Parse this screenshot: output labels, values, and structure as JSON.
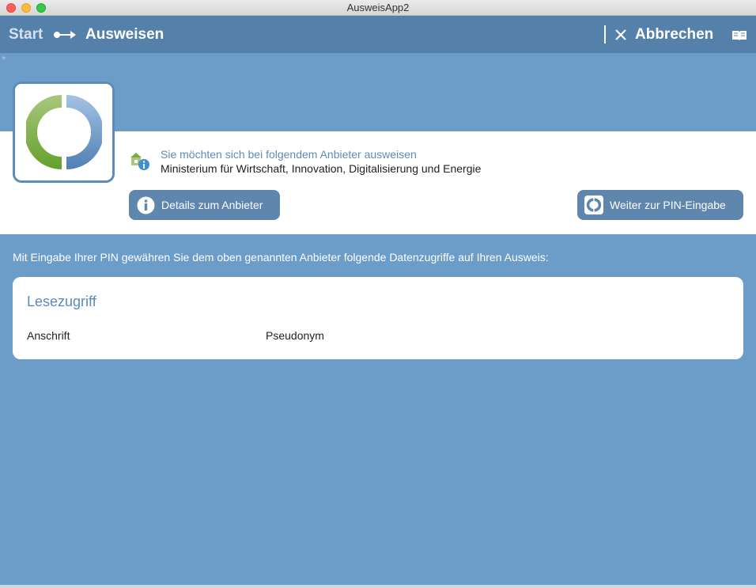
{
  "window": {
    "title": "AusweisApp2"
  },
  "navbar": {
    "breadcrumb_start": "Start",
    "breadcrumb_current": "Ausweisen",
    "cancel_label": "Abbrechen"
  },
  "provider": {
    "question": "Sie möchten sich bei folgendem Anbieter ausweisen",
    "name": "Ministerium für Wirtschaft, Innovation, Digitalisierung und Energie",
    "details_button": "Details zum Anbieter",
    "continue_button": "Weiter zur PIN-Eingabe"
  },
  "info_text": "Mit Eingabe Ihrer PIN gewähren Sie dem oben genannten Anbieter folgende Datenzugriffe auf Ihren Ausweis:",
  "access": {
    "title": "Lesezugriff",
    "items": [
      "Anschrift",
      "Pseudonym"
    ]
  },
  "colors": {
    "navbar": "#5480aa",
    "background": "#6c9cc8",
    "button": "#5f86ad",
    "accent_text": "#5d8ab8",
    "logo_green": "#7aad3e",
    "logo_blue": "#6f9ccb"
  },
  "icons": [
    "arrow-right-icon",
    "close-icon",
    "book-icon",
    "provider-info-icon",
    "info-icon",
    "ausweis-logo-icon"
  ]
}
